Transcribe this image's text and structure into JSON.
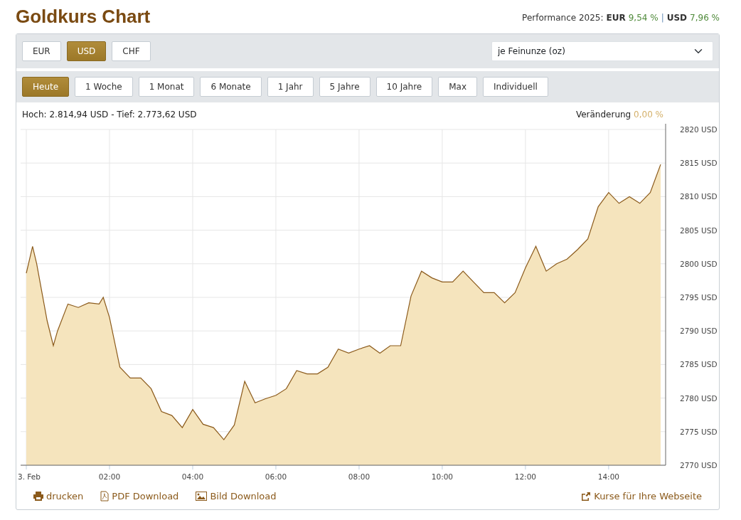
{
  "title": "Goldkurs Chart",
  "performance": {
    "label": "Performance 2025:",
    "separator": "|",
    "items": [
      {
        "currency": "EUR",
        "value": "9,54 %"
      },
      {
        "currency": "USD",
        "value": "7,96 %"
      }
    ]
  },
  "currencies": [
    {
      "label": "EUR",
      "selected": false
    },
    {
      "label": "USD",
      "selected": true
    },
    {
      "label": "CHF",
      "selected": false
    }
  ],
  "unit_select": {
    "value": "je Feinunze (oz)"
  },
  "ranges": [
    {
      "label": "Heute",
      "selected": true
    },
    {
      "label": "1 Woche",
      "selected": false
    },
    {
      "label": "1 Monat",
      "selected": false
    },
    {
      "label": "6 Monate",
      "selected": false
    },
    {
      "label": "1 Jahr",
      "selected": false
    },
    {
      "label": "5 Jahre",
      "selected": false
    },
    {
      "label": "10 Jahre",
      "selected": false
    },
    {
      "label": "Max",
      "selected": false
    },
    {
      "label": "Individuell",
      "selected": false
    }
  ],
  "summary": {
    "high_low": "Hoch: 2.814,94 USD - Tief: 2.773,62 USD",
    "change_label": "Veränderung",
    "change_value": "0,00 %"
  },
  "chart_data": {
    "type": "area",
    "grid": true,
    "xlim": [
      -0.137,
      15.37
    ],
    "ylim": [
      2770,
      2820
    ],
    "xticks": [
      {
        "value": 0,
        "label": "3. Feb"
      },
      {
        "value": 2,
        "label": "02:00"
      },
      {
        "value": 4,
        "label": "04:00"
      },
      {
        "value": 6,
        "label": "06:00"
      },
      {
        "value": 8,
        "label": "08:00"
      },
      {
        "value": 10,
        "label": "10:00"
      },
      {
        "value": 12,
        "label": "12:00"
      },
      {
        "value": 14,
        "label": "14:00"
      }
    ],
    "yticks": [
      {
        "value": 2770,
        "label": "2770 USD"
      },
      {
        "value": 2775,
        "label": "2775 USD"
      },
      {
        "value": 2780,
        "label": "2780 USD"
      },
      {
        "value": 2785,
        "label": "2785 USD"
      },
      {
        "value": 2790,
        "label": "2790 USD"
      },
      {
        "value": 2795,
        "label": "2795 USD"
      },
      {
        "value": 2800,
        "label": "2800 USD"
      },
      {
        "value": 2805,
        "label": "2805 USD"
      },
      {
        "value": 2810,
        "label": "2810 USD"
      },
      {
        "value": 2815,
        "label": "2815 USD"
      },
      {
        "value": 2820,
        "label": "2820 USD"
      }
    ],
    "x": [
      0,
      0.15,
      0.25,
      0.5,
      0.65,
      0.75,
      1,
      1.25,
      1.5,
      1.75,
      1.85,
      2,
      2.25,
      2.5,
      2.75,
      3,
      3.25,
      3.5,
      3.75,
      4,
      4.25,
      4.5,
      4.75,
      5,
      5.25,
      5.5,
      5.75,
      6,
      6.25,
      6.5,
      6.75,
      7,
      7.25,
      7.5,
      7.75,
      8,
      8.25,
      8.5,
      8.75,
      9,
      9.25,
      9.5,
      9.75,
      10,
      10.25,
      10.5,
      10.75,
      11,
      11.25,
      11.5,
      11.75,
      12,
      12.25,
      12.5,
      12.75,
      13,
      13.25,
      13.5,
      13.75,
      14,
      14.25,
      14.5,
      14.75,
      15,
      15.25
    ],
    "series": [
      {
        "color": "#8b5a1b",
        "values": [
          2798.6,
          2802.6,
          2800,
          2791.5,
          2787.8,
          2790,
          2794,
          2793.5,
          2794.2,
          2794,
          2795,
          2792,
          2784.6,
          2783,
          2783,
          2781.4,
          2778,
          2777.4,
          2775.6,
          2778.3,
          2776.1,
          2775.6,
          2773.8,
          2776,
          2782.5,
          2779.3,
          2779.9,
          2780.4,
          2781.4,
          2784.1,
          2783.6,
          2783.6,
          2784.6,
          2787.3,
          2786.7,
          2787.3,
          2787.8,
          2786.7,
          2787.8,
          2787.8,
          2795.2,
          2798.9,
          2797.9,
          2797.3,
          2797.3,
          2798.9,
          2797.3,
          2795.7,
          2795.7,
          2794.2,
          2795.7,
          2799.4,
          2802.6,
          2798.9,
          2800,
          2800.7,
          2802.1,
          2803.7,
          2808.5,
          2810.6,
          2809,
          2810,
          2809,
          2810.6,
          2814.8
        ]
      }
    ]
  },
  "footer_links": [
    {
      "kind": "print",
      "label": "drucken"
    },
    {
      "kind": "pdf",
      "label": "PDF Download"
    },
    {
      "kind": "image",
      "label": "Bild Download"
    },
    {
      "kind": "share",
      "label": "Kurse für Ihre Webseite"
    }
  ]
}
